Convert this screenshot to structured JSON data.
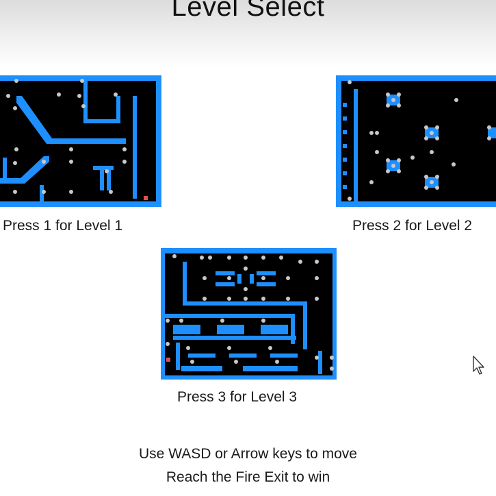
{
  "header": {
    "title": "Level Select"
  },
  "levels": [
    {
      "number": 1,
      "caption": "Press 1 for Level 1",
      "key": "1"
    },
    {
      "number": 2,
      "caption": "Press 2 for Level 2",
      "key": "2"
    },
    {
      "number": 3,
      "caption": "Press 3 for Level 3",
      "key": "3"
    }
  ],
  "instructions": {
    "move": "Use WASD or Arrow keys to move",
    "goal": "Reach the Fire Exit to win"
  },
  "colors": {
    "wall": "#1e8fff",
    "floor": "#000000",
    "coin": "#c8c8c8",
    "fire_exit": "#e05050",
    "background": "#ffffff"
  },
  "icons": {
    "cursor": "mouse-pointer-icon"
  }
}
